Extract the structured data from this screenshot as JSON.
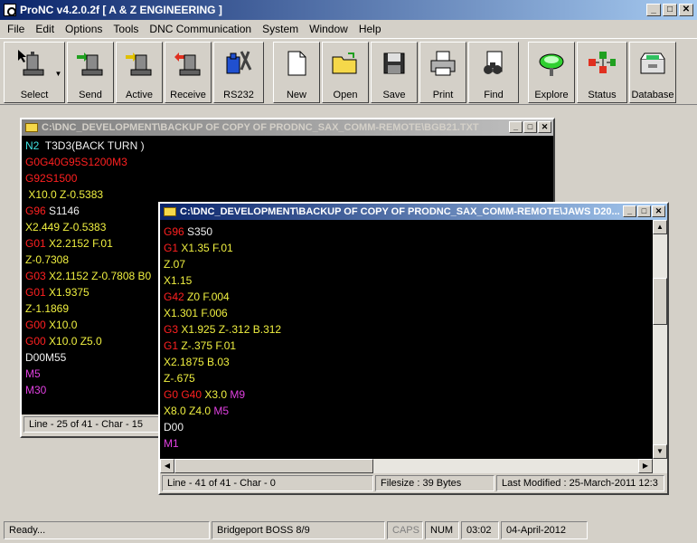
{
  "app": {
    "title": "ProNC v4.2.0.2f [ A & Z ENGINEERING ]"
  },
  "menu": [
    "File",
    "Edit",
    "Options",
    "Tools",
    "DNC Communication",
    "System",
    "Window",
    "Help"
  ],
  "toolbar": {
    "select": "Select",
    "send": "Send",
    "active": "Active",
    "receive": "Receive",
    "rs232": "RS232",
    "new": "New",
    "open": "Open",
    "save": "Save",
    "print": "Print",
    "find": "Find",
    "explore": "Explore",
    "status": "Status",
    "database": "Database"
  },
  "win1": {
    "title": "C:\\DNC_DEVELOPMENT\\BACKUP OF COPY OF PRODNC_SAX_COMM-REMOTE\\BGB21.TXT",
    "lines": [
      [
        [
          "c",
          "N2"
        ],
        [
          "w",
          "  T3D3(BACK TURN )"
        ]
      ],
      [
        [
          "r",
          "G0G40G95S1200M3"
        ]
      ],
      [
        [
          "r",
          "G92S1500"
        ]
      ],
      [
        [
          "y",
          " X10.0 Z-0.5383"
        ]
      ],
      [
        [
          "r",
          "G96"
        ],
        [
          "w",
          " S1146"
        ]
      ],
      [
        [
          "y",
          "X2.449 Z-0.5383"
        ]
      ],
      [
        [
          "r",
          "G01"
        ],
        [
          "y",
          " X2.2152 F.01"
        ]
      ],
      [
        [
          "y",
          "Z-0.7308"
        ]
      ],
      [
        [
          "r",
          "G03"
        ],
        [
          "y",
          " X2.1152 Z-0.7808 B0"
        ]
      ],
      [
        [
          "r",
          "G01"
        ],
        [
          "y",
          " X1.9375"
        ]
      ],
      [
        [
          "y",
          "Z-1.1869"
        ]
      ],
      [
        [
          "r",
          "G00"
        ],
        [
          "y",
          " X10.0"
        ]
      ],
      [
        [
          "r",
          "G00"
        ],
        [
          "y",
          " X10.0 Z5.0"
        ]
      ],
      [
        [
          "w",
          "D00M55"
        ]
      ],
      [
        [
          "m",
          "M5"
        ]
      ],
      [
        [
          "m",
          "M30"
        ]
      ]
    ],
    "status": "Line - 25 of 41 - Char - 15"
  },
  "win2": {
    "title": "C:\\DNC_DEVELOPMENT\\BACKUP OF COPY OF PRODNC_SAX_COMM-REMOTE\\JAWS D20...",
    "lines": [
      [
        [
          "r",
          "G96"
        ],
        [
          "w",
          " S350"
        ]
      ],
      [
        [
          "r",
          "G1"
        ],
        [
          "y",
          " X1.35 F.01"
        ]
      ],
      [
        [
          "y",
          "Z.07"
        ]
      ],
      [
        [
          "y",
          "X1.15"
        ]
      ],
      [
        [
          "r",
          "G42"
        ],
        [
          "y",
          " Z0 F.004"
        ]
      ],
      [
        [
          "y",
          "X1.301 F.006"
        ]
      ],
      [
        [
          "r",
          "G3"
        ],
        [
          "y",
          " X1.925 Z-.312 B.312"
        ]
      ],
      [
        [
          "r",
          "G1"
        ],
        [
          "y",
          " Z-.375 F.01"
        ]
      ],
      [
        [
          "y",
          "X2.1875 B.03"
        ]
      ],
      [
        [
          "y",
          "Z-.675"
        ]
      ],
      [
        [
          "r",
          "G0 G40"
        ],
        [
          "y",
          " X3.0 "
        ],
        [
          "m",
          "M9"
        ]
      ],
      [
        [
          "y",
          "X8.0 Z4.0 "
        ],
        [
          "m",
          "M5"
        ]
      ],
      [
        [
          "w",
          "D00"
        ]
      ],
      [
        [
          "m",
          "M1"
        ]
      ]
    ],
    "status": {
      "line": "Line - 41 of 41 - Char - 0",
      "filesize": "Filesize : 39 Bytes",
      "modified": "Last Modified : 25-March-2011 12:3"
    }
  },
  "statusbar": {
    "ready": "Ready...",
    "machine": "Bridgeport BOSS 8/9",
    "caps": "CAPS",
    "num": "NUM",
    "time": "03:02",
    "date": "04-April-2012"
  },
  "colors": {
    "accent": "#0a246a",
    "code_bg": "#000000",
    "gcode": "#ff2020",
    "coord": "#f0f040",
    "mcode": "#e040e0"
  }
}
